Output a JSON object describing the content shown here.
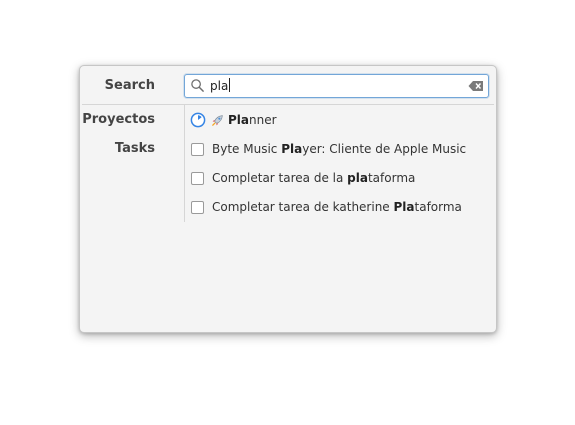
{
  "search": {
    "label": "Search",
    "value": "pla"
  },
  "sections": {
    "projects_label": "Proyectos",
    "tasks_label": "Tasks"
  },
  "projects": [
    {
      "pre": "",
      "match": "Pla",
      "post": "nner",
      "icon": "rocket-icon"
    }
  ],
  "tasks": [
    {
      "pre": "Byte Music ",
      "match": "Pla",
      "post": "yer: Cliente de Apple Music"
    },
    {
      "pre": "Completar tarea de la ",
      "match": "pla",
      "post": "taforma"
    },
    {
      "pre": "Completar tarea de katherine ",
      "match": "Pla",
      "post": "taforma"
    }
  ],
  "colors": {
    "accent": "#3584e4",
    "focus_border": "#73a6d8"
  }
}
